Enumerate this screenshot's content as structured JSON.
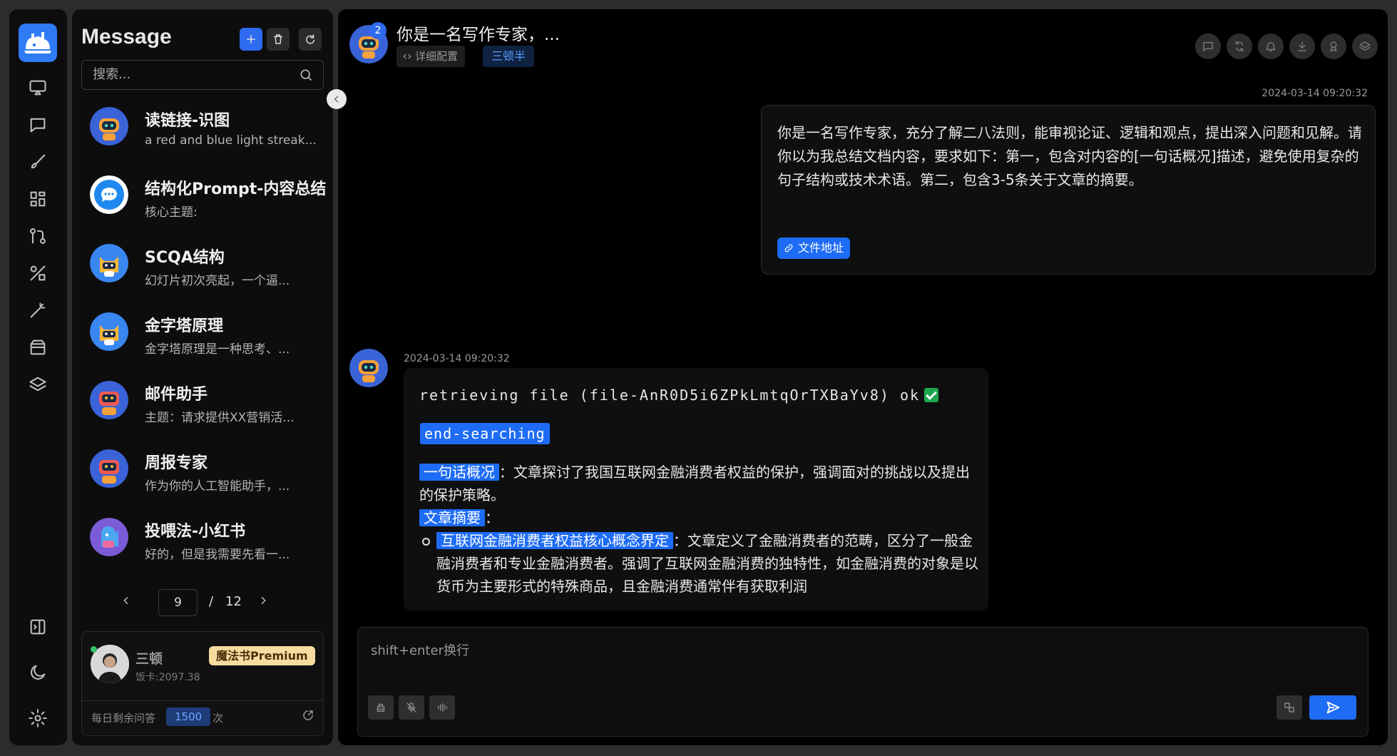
{
  "sidebar": {
    "panel_title": "Message",
    "search_placeholder": "搜索...",
    "conversations": [
      {
        "name": "读链接-识图",
        "preview": "a red and blue light streak..."
      },
      {
        "name": "结构化Prompt-内容总结",
        "preview": "核心主题:"
      },
      {
        "name": "SCQA结构",
        "preview": "幻灯片初次亮起，一个逼..."
      },
      {
        "name": "金字塔原理",
        "preview": "金字塔原理是一种思考、..."
      },
      {
        "name": "邮件助手",
        "preview": "主题：请求提供XX营销活..."
      },
      {
        "name": "周报专家",
        "preview": "作为你的人工智能助手，..."
      },
      {
        "name": "投喂法-小红书",
        "preview": "好的，但是我需要先看一..."
      }
    ],
    "pagination": {
      "current": "9",
      "separator": "/",
      "total": "12"
    },
    "user": {
      "name": "三顿",
      "balance": "饭卡:2097.38",
      "tier": "魔法书Premium",
      "quota_label": "每日剩余问答",
      "quota_value": "1500",
      "quota_unit": "次"
    }
  },
  "chat": {
    "title": "你是一名写作专家，...",
    "badge_count": "2",
    "tag_detail": "详细配置",
    "tag_user": "三顿半",
    "user_message": {
      "timestamp": "2024-03-14 09:20:32",
      "text": "你是一名写作专家，充分了解二八法则，能审视论证、逻辑和观点，提出深入问题和见解。请你以为我总结文档内容，要求如下：第一，包含对内容的[一句话概况]描述，避免使用复杂的句子结构或技术术语。第二，包含3-5条关于文章的摘要。",
      "file_link": "文件地址"
    },
    "bot_message": {
      "timestamp": "2024-03-14 09:20:32",
      "retrieving": "retrieving file (file-AnR0D5i6ZPkLmtqOrTXBaYv8) ok",
      "end_searching": "end-searching",
      "summary_label": "一句话概况",
      "summary_text": "：文章探讨了我国互联网金融消费者权益的保护，强调面对的挑战以及提出的保护策略。",
      "abstract_label": "文章摘要",
      "abstract_colon": "：",
      "point1_label": "互联网金融消费者权益核心概念界定",
      "point1_text": "：文章定义了金融消费者的范畴，区分了一般金融消费者和专业金融消费者。强调了互联网金融消费的独特性，如金融消费的对象是以货币为主要形式的特殊商品，且金融消费通常伴有获取利润"
    },
    "input_placeholder": "shift+enter换行"
  },
  "colors": {
    "accent": "#1e6cf5",
    "background": "#000000",
    "panel": "#0d0d0d",
    "premium": "#f7dca0"
  }
}
